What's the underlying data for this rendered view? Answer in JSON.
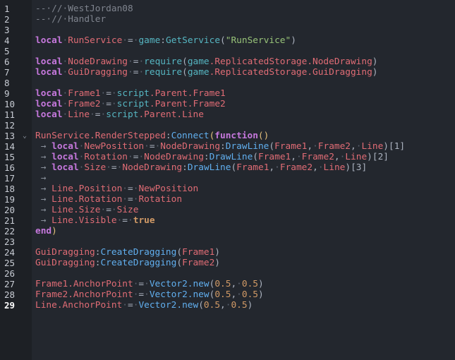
{
  "editor": {
    "current_line": 29,
    "fold_line": 13,
    "lines": [
      [
        [
          "c",
          "--·//·WestJordan08"
        ]
      ],
      [
        [
          "c",
          "--·//·Handler"
        ]
      ],
      [],
      [
        [
          "k",
          "local"
        ],
        [
          "w",
          "·"
        ],
        [
          "v",
          "RunService"
        ],
        [
          "w",
          "·"
        ],
        [
          "p",
          "="
        ],
        [
          "w",
          "·"
        ],
        [
          "g",
          "game"
        ],
        [
          "p",
          ":"
        ],
        [
          "g",
          "GetService"
        ],
        [
          "p",
          "("
        ],
        [
          "s",
          "\"RunService\""
        ],
        [
          "p",
          ")"
        ]
      ],
      [],
      [
        [
          "k",
          "local"
        ],
        [
          "w",
          "·"
        ],
        [
          "v",
          "NodeDrawing"
        ],
        [
          "w",
          "·"
        ],
        [
          "p",
          "="
        ],
        [
          "w",
          "·"
        ],
        [
          "g",
          "require"
        ],
        [
          "p",
          "("
        ],
        [
          "g",
          "game"
        ],
        [
          "v",
          ".ReplicatedStorage.NodeDrawing"
        ],
        [
          "p",
          ")"
        ]
      ],
      [
        [
          "k",
          "local"
        ],
        [
          "w",
          "·"
        ],
        [
          "v",
          "GuiDragging"
        ],
        [
          "w",
          "·"
        ],
        [
          "p",
          "="
        ],
        [
          "w",
          "·"
        ],
        [
          "g",
          "require"
        ],
        [
          "p",
          "("
        ],
        [
          "g",
          "game"
        ],
        [
          "v",
          ".ReplicatedStorage.GuiDragging"
        ],
        [
          "p",
          ")"
        ]
      ],
      [],
      [
        [
          "k",
          "local"
        ],
        [
          "w",
          "·"
        ],
        [
          "v",
          "Frame1"
        ],
        [
          "w",
          "·"
        ],
        [
          "p",
          "="
        ],
        [
          "w",
          "·"
        ],
        [
          "g",
          "script"
        ],
        [
          "v",
          ".Parent.Frame1"
        ]
      ],
      [
        [
          "k",
          "local"
        ],
        [
          "w",
          "·"
        ],
        [
          "v",
          "Frame2"
        ],
        [
          "w",
          "·"
        ],
        [
          "p",
          "="
        ],
        [
          "w",
          "·"
        ],
        [
          "g",
          "script"
        ],
        [
          "v",
          ".Parent.Frame2"
        ]
      ],
      [
        [
          "k",
          "local"
        ],
        [
          "w",
          "·"
        ],
        [
          "v",
          "Line"
        ],
        [
          "w",
          "·"
        ],
        [
          "p",
          "="
        ],
        [
          "w",
          "·"
        ],
        [
          "g",
          "script"
        ],
        [
          "v",
          ".Parent.Line"
        ]
      ],
      [],
      [
        [
          "v",
          "RunService.RenderStepped"
        ],
        [
          "p",
          ":"
        ],
        [
          "f",
          "Connect"
        ],
        [
          "y",
          "("
        ],
        [
          "k",
          "function"
        ],
        [
          "y",
          "()"
        ]
      ],
      [
        [
          "a",
          " → "
        ],
        [
          "k",
          "local"
        ],
        [
          "w",
          "·"
        ],
        [
          "v",
          "NewPosition"
        ],
        [
          "w",
          "·"
        ],
        [
          "p",
          "="
        ],
        [
          "w",
          "·"
        ],
        [
          "v",
          "NodeDrawing"
        ],
        [
          "p",
          ":"
        ],
        [
          "f",
          "DrawLine"
        ],
        [
          "p",
          "("
        ],
        [
          "v",
          "Frame1"
        ],
        [
          "p",
          ","
        ],
        [
          "w",
          "·"
        ],
        [
          "v",
          "Frame2"
        ],
        [
          "p",
          ","
        ],
        [
          "w",
          "·"
        ],
        [
          "v",
          "Line"
        ],
        [
          "p",
          ")[1]"
        ]
      ],
      [
        [
          "a",
          " → "
        ],
        [
          "k",
          "local"
        ],
        [
          "w",
          "·"
        ],
        [
          "v",
          "Rotation"
        ],
        [
          "w",
          "·"
        ],
        [
          "p",
          "="
        ],
        [
          "w",
          "·"
        ],
        [
          "v",
          "NodeDrawing"
        ],
        [
          "p",
          ":"
        ],
        [
          "f",
          "DrawLine"
        ],
        [
          "p",
          "("
        ],
        [
          "v",
          "Frame1"
        ],
        [
          "p",
          ","
        ],
        [
          "w",
          "·"
        ],
        [
          "v",
          "Frame2"
        ],
        [
          "p",
          ","
        ],
        [
          "w",
          "·"
        ],
        [
          "v",
          "Line"
        ],
        [
          "p",
          ")[2]"
        ]
      ],
      [
        [
          "a",
          " → "
        ],
        [
          "k",
          "local"
        ],
        [
          "w",
          "·"
        ],
        [
          "v",
          "Size"
        ],
        [
          "w",
          "·"
        ],
        [
          "p",
          "="
        ],
        [
          "w",
          "·"
        ],
        [
          "v",
          "NodeDrawing"
        ],
        [
          "p",
          ":"
        ],
        [
          "f",
          "DrawLine"
        ],
        [
          "p",
          "("
        ],
        [
          "v",
          "Frame1"
        ],
        [
          "p",
          ","
        ],
        [
          "w",
          "·"
        ],
        [
          "v",
          "Frame2"
        ],
        [
          "p",
          ","
        ],
        [
          "w",
          "·"
        ],
        [
          "v",
          "Line"
        ],
        [
          "p",
          ")[3]"
        ]
      ],
      [
        [
          "a",
          " → "
        ]
      ],
      [
        [
          "a",
          " → "
        ],
        [
          "v",
          "Line.Position"
        ],
        [
          "w",
          "·"
        ],
        [
          "p",
          "="
        ],
        [
          "w",
          "·"
        ],
        [
          "v",
          "NewPosition"
        ]
      ],
      [
        [
          "a",
          " → "
        ],
        [
          "v",
          "Line.Rotation"
        ],
        [
          "w",
          "·"
        ],
        [
          "p",
          "="
        ],
        [
          "w",
          "·"
        ],
        [
          "v",
          "Rotation"
        ]
      ],
      [
        [
          "a",
          " → "
        ],
        [
          "v",
          "Line.Size"
        ],
        [
          "w",
          "·"
        ],
        [
          "p",
          "="
        ],
        [
          "w",
          "·"
        ],
        [
          "v",
          "Size"
        ]
      ],
      [
        [
          "a",
          " → "
        ],
        [
          "v",
          "Line.Visible"
        ],
        [
          "w",
          "·"
        ],
        [
          "p",
          "="
        ],
        [
          "w",
          "·"
        ],
        [
          "b",
          "true"
        ]
      ],
      [
        [
          "k",
          "end"
        ],
        [
          "y",
          ")"
        ]
      ],
      [],
      [
        [
          "v",
          "GuiDragging"
        ],
        [
          "p",
          ":"
        ],
        [
          "f",
          "CreateDragging"
        ],
        [
          "p",
          "("
        ],
        [
          "v",
          "Frame1"
        ],
        [
          "p",
          ")"
        ]
      ],
      [
        [
          "v",
          "GuiDragging"
        ],
        [
          "p",
          ":"
        ],
        [
          "f",
          "CreateDragging"
        ],
        [
          "p",
          "("
        ],
        [
          "v",
          "Frame2"
        ],
        [
          "p",
          ")"
        ]
      ],
      [],
      [
        [
          "v",
          "Frame1.AnchorPoint"
        ],
        [
          "w",
          "·"
        ],
        [
          "p",
          "="
        ],
        [
          "w",
          "·"
        ],
        [
          "f",
          "Vector2.new"
        ],
        [
          "p",
          "("
        ],
        [
          "n",
          "0.5"
        ],
        [
          "p",
          ","
        ],
        [
          "w",
          "·"
        ],
        [
          "n",
          "0.5"
        ],
        [
          "p",
          ")"
        ]
      ],
      [
        [
          "v",
          "Frame2.AnchorPoint"
        ],
        [
          "w",
          "·"
        ],
        [
          "p",
          "="
        ],
        [
          "w",
          "·"
        ],
        [
          "f",
          "Vector2.new"
        ],
        [
          "p",
          "("
        ],
        [
          "n",
          "0.5"
        ],
        [
          "p",
          ","
        ],
        [
          "w",
          "·"
        ],
        [
          "n",
          "0.5"
        ],
        [
          "p",
          ")"
        ]
      ],
      [
        [
          "v",
          "Line.AnchorPoint"
        ],
        [
          "w",
          "·"
        ],
        [
          "p",
          "="
        ],
        [
          "w",
          "·"
        ],
        [
          "f",
          "Vector2.new"
        ],
        [
          "p",
          "("
        ],
        [
          "n",
          "0.5"
        ],
        [
          "p",
          ","
        ],
        [
          "w",
          "·"
        ],
        [
          "n",
          "0.5"
        ],
        [
          "p",
          ")"
        ]
      ]
    ]
  }
}
